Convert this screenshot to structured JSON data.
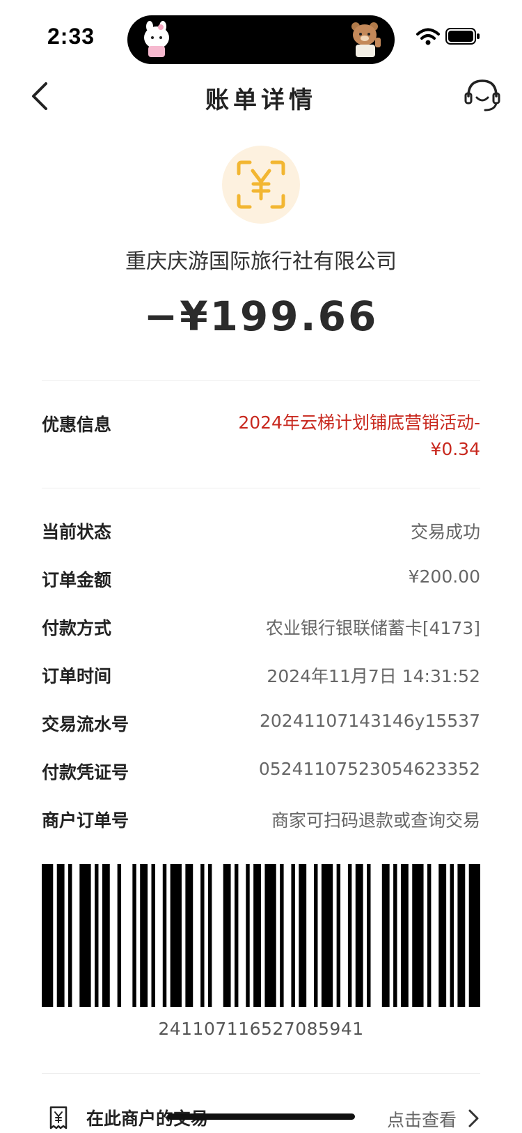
{
  "status_bar": {
    "time": "2:33"
  },
  "nav": {
    "title": "账单详情",
    "back_icon": "chevron-left-icon",
    "service_icon": "customer-service-icon"
  },
  "merchant": {
    "icon": "yuan-scan-icon",
    "name": "重庆庆游国际旅行社有限公司"
  },
  "amount": "−¥199.66",
  "discount": {
    "label": "优惠信息",
    "value": "2024年云梯计划铺底营销活动-¥0.34"
  },
  "details": [
    {
      "label": "当前状态",
      "value": "交易成功"
    },
    {
      "label": "订单金额",
      "value": "¥200.00"
    },
    {
      "label": "付款方式",
      "value": "农业银行银联储蓄卡[4173]"
    },
    {
      "label": "订单时间",
      "value": "2024年11月7日 14:31:52"
    },
    {
      "label": "交易流水号",
      "value": "20241107143146y15537"
    },
    {
      "label": "付款凭证号",
      "value": "052411075230546233​52"
    },
    {
      "label": "商户订单号",
      "value": "商家可扫码退款或查询交易"
    }
  ],
  "barcode": {
    "number": "241107116527085941"
  },
  "footer": {
    "label": "在此商户的交易",
    "link": "点击查看"
  },
  "colors": {
    "accent_red": "#c8281e",
    "icon_yellow": "#f2b632",
    "icon_bg": "#fdf1df"
  }
}
